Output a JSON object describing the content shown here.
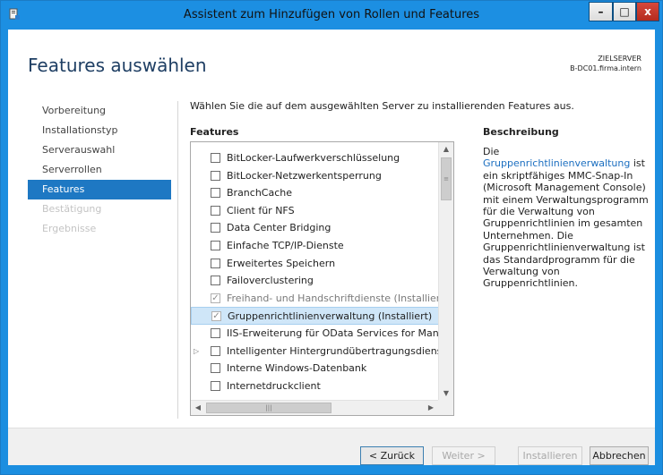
{
  "window": {
    "title": "Assistent zum Hinzufügen von Rollen und Features",
    "minimize_label": "–",
    "maximize_label": "□",
    "close_label": "x"
  },
  "header": {
    "page_title": "Features auswählen",
    "target_label": "ZIELSERVER",
    "target_server": "B-DC01.firma.intern"
  },
  "nav": {
    "items": [
      {
        "label": "Vorbereitung",
        "state": "normal"
      },
      {
        "label": "Installationstyp",
        "state": "normal"
      },
      {
        "label": "Serverauswahl",
        "state": "normal"
      },
      {
        "label": "Serverrollen",
        "state": "normal"
      },
      {
        "label": "Features",
        "state": "active"
      },
      {
        "label": "Bestätigung",
        "state": "disabled"
      },
      {
        "label": "Ergebnisse",
        "state": "disabled"
      }
    ]
  },
  "main": {
    "intro": "Wählen Sie die auf dem ausgewählten Server zu installierenden Features aus.",
    "features_heading": "Features",
    "description_heading": "Beschreibung",
    "features": [
      {
        "label": "BitLocker-Laufwerkverschlüsselung",
        "checked": false,
        "grayed": false,
        "selected": false,
        "expander": false
      },
      {
        "label": "BitLocker-Netzwerkentsperrung",
        "checked": false,
        "grayed": false,
        "selected": false,
        "expander": false
      },
      {
        "label": "BranchCache",
        "checked": false,
        "grayed": false,
        "selected": false,
        "expander": false
      },
      {
        "label": "Client für NFS",
        "checked": false,
        "grayed": false,
        "selected": false,
        "expander": false
      },
      {
        "label": "Data Center Bridging",
        "checked": false,
        "grayed": false,
        "selected": false,
        "expander": false
      },
      {
        "label": "Einfache TCP/IP-Dienste",
        "checked": false,
        "grayed": false,
        "selected": false,
        "expander": false
      },
      {
        "label": "Erweitertes Speichern",
        "checked": false,
        "grayed": false,
        "selected": false,
        "expander": false
      },
      {
        "label": "Failoverclustering",
        "checked": false,
        "grayed": false,
        "selected": false,
        "expander": false
      },
      {
        "label": "Freihand- und Handschriftdienste (Installiert)",
        "checked": true,
        "grayed": true,
        "selected": false,
        "expander": false
      },
      {
        "label": "Gruppenrichtlinienverwaltung (Installiert)",
        "checked": true,
        "grayed": true,
        "selected": true,
        "expander": false
      },
      {
        "label": "IIS-Erweiterung für OData Services for Management",
        "checked": false,
        "grayed": false,
        "selected": false,
        "expander": false
      },
      {
        "label": "Intelligenter Hintergrundübertragungsdienst (Back",
        "checked": false,
        "grayed": false,
        "selected": false,
        "expander": true
      },
      {
        "label": "Interne Windows-Datenbank",
        "checked": false,
        "grayed": false,
        "selected": false,
        "expander": false
      },
      {
        "label": "Internetdruckclient",
        "checked": false,
        "grayed": false,
        "selected": false,
        "expander": false
      }
    ],
    "description": {
      "prefix": "Die ",
      "link": "Gruppenrichtlinienverwaltung",
      "body": " ist ein skriptfähiges MMC-Snap-In (Microsoft Management Console) mit einem Verwaltungsprogramm für die Verwaltung von Gruppenrichtlinien im gesamten Unternehmen. Die Gruppenrichtlinienverwaltung ist das Standardprogramm für die Verwaltung von Gruppenrichtlinien."
    }
  },
  "footer": {
    "back": "< Zurück",
    "next": "Weiter >",
    "install": "Installieren",
    "cancel": "Abbrechen"
  },
  "colors": {
    "accent": "#1e78c3",
    "title_bar": "#1c8fe2",
    "selection": "#cfe6f8",
    "link": "#1c6fc0"
  }
}
